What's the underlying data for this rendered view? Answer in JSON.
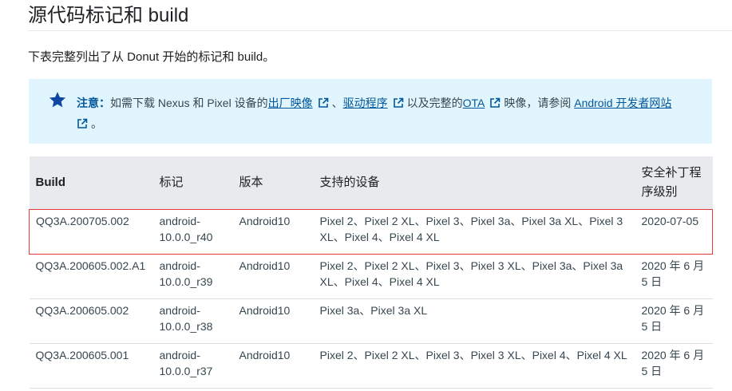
{
  "page": {
    "title": "源代码标记和 build",
    "intro": "下表完整列出了从 Donut 开始的标记和 build。"
  },
  "note": {
    "icon": "star-icon",
    "label": "注意：",
    "text_1": "如需下载 Nexus 和 Pixel 设备的",
    "link_factory_images": "出厂映像",
    "sep_1": "、",
    "link_drivers": "驱动程序",
    "text_2": "以及完整的",
    "link_ota": "OTA",
    "text_3": "映像，请参阅",
    "link_dev_site": "Android 开发者网站",
    "text_end": "。"
  },
  "table": {
    "headers": [
      "Build",
      "标记",
      "版本",
      "支持的设备",
      "安全补丁程序级别"
    ],
    "rows": [
      {
        "build": "QQ3A.200705.002",
        "tag": "android-10.0.0_r40",
        "version": "Android10",
        "devices": "Pixel 2、Pixel 2 XL、Pixel 3、Pixel 3a、Pixel 3a XL、Pixel 3 XL、Pixel 4、Pixel 4 XL",
        "patch": "2020-07-05"
      },
      {
        "build": "QQ3A.200605.002.A1",
        "tag": "android-10.0.0_r39",
        "version": "Android10",
        "devices": "Pixel 2、Pixel 2 XL、Pixel 3、Pixel 3 XL、Pixel 3a、Pixel 3a XL、Pixel 4、Pixel 4 XL",
        "patch": "2020 年 6 月 5 日"
      },
      {
        "build": "QQ3A.200605.002",
        "tag": "android-10.0.0_r38",
        "version": "Android10",
        "devices": "Pixel 3a、Pixel 3a XL",
        "patch": "2020 年 6 月 5 日"
      },
      {
        "build": "QQ3A.200605.001",
        "tag": "android-10.0.0_r37",
        "version": "Android10",
        "devices": "Pixel 2、Pixel 2 XL、Pixel 3、Pixel 3 XL、Pixel 4、Pixel 4 XL",
        "patch": "2020 年 6 月 5 日"
      }
    ]
  },
  "colors": {
    "note_background": "#e1f5fe",
    "link": "#01579b",
    "star": "#0d47a1",
    "header_background": "#e8eaed",
    "highlight_border": "#e53935"
  }
}
